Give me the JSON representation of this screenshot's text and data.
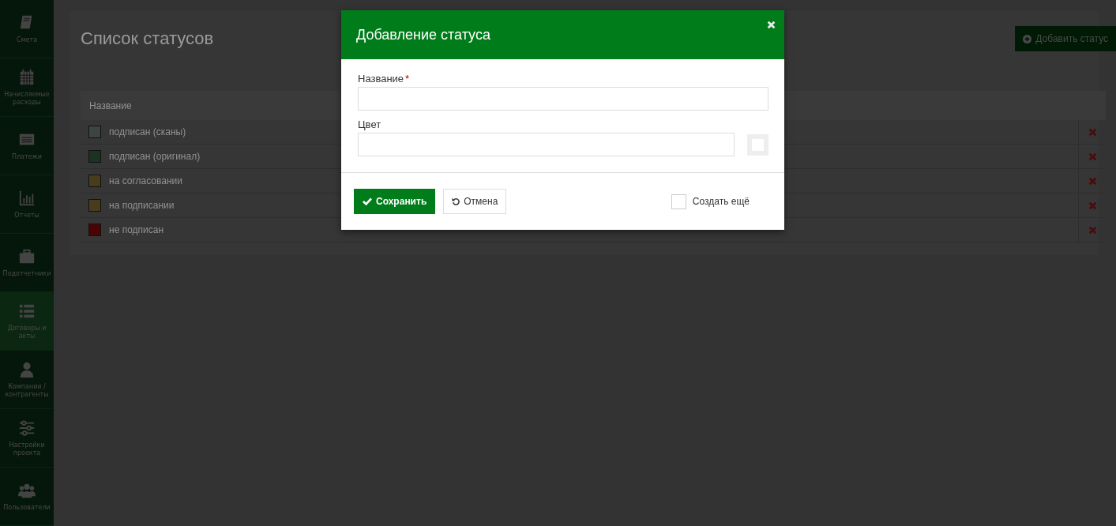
{
  "sidebar": {
    "items": [
      {
        "label": "Смета",
        "selected": false
      },
      {
        "label": "Начисляемые расходы",
        "selected": false
      },
      {
        "label": "Платежи",
        "selected": false
      },
      {
        "label": "Отчеты",
        "selected": false
      },
      {
        "label": "Подотчетники",
        "selected": false
      },
      {
        "label": "Договоры и акты",
        "selected": true
      },
      {
        "label": "Компании / контрагенты",
        "selected": false
      },
      {
        "label": "Настройки проекта",
        "selected": false
      },
      {
        "label": "Пользователи",
        "selected": false
      }
    ]
  },
  "page": {
    "title": "Список статусов",
    "add_button": "Добавить статус"
  },
  "table": {
    "columns": [
      "Название"
    ],
    "rows": [
      {
        "name": "подписан (сканы)",
        "color": "#3e4540"
      },
      {
        "name": "подписан (оригинал)",
        "color": "#1c3321"
      },
      {
        "name": "на согласовании",
        "color": "#473c1c"
      },
      {
        "name": "на подписании",
        "color": "#473c1c"
      },
      {
        "name": "не подписан",
        "color": "#4a0404"
      }
    ]
  },
  "dialog": {
    "title": "Добавление статуса",
    "fields": [
      {
        "label": "Название",
        "required_mark": "*",
        "kind": "text"
      },
      {
        "label": "Цвет",
        "kind": "color"
      }
    ],
    "save_button": "Сохранить",
    "cancel_button": "Отмена",
    "create_another": {
      "label": "Создать ещё",
      "checked": false
    }
  }
}
